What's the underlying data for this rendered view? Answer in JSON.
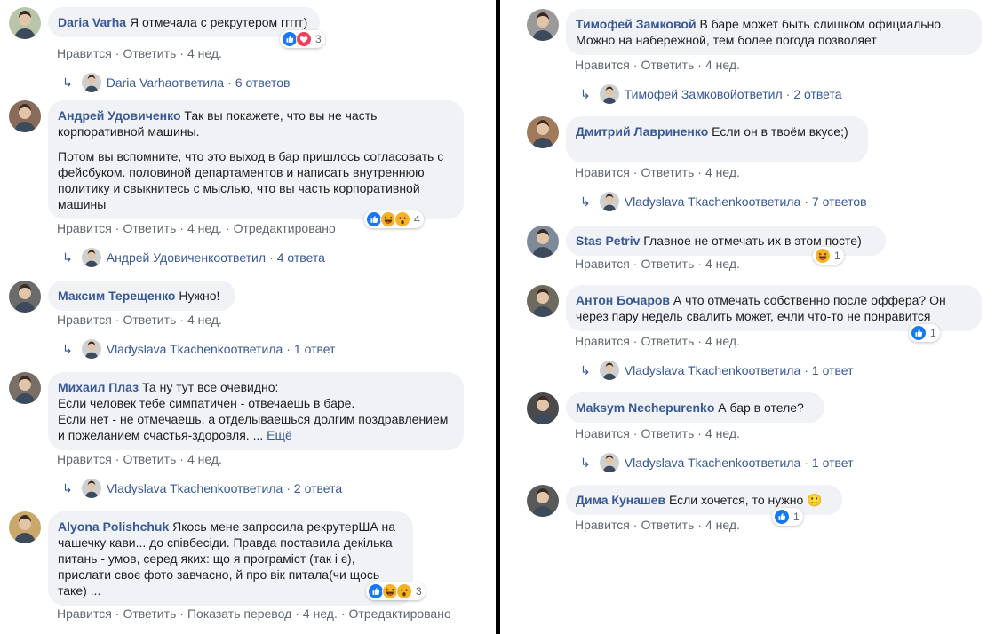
{
  "left_column": [
    {
      "author": "Daria Varha",
      "paragraphs": [
        "Я отмечала с рекрутером ггггг)"
      ],
      "reactions": {
        "icons": [
          "like-icon",
          "love-icon"
        ],
        "count": "3"
      },
      "actions": [
        "Нравится",
        "Ответить",
        "4 нед."
      ],
      "reply": {
        "author": "Daria Varha",
        "label": "ответила",
        "count": "6 ответов"
      },
      "avatar_color": "#b8c5a8"
    },
    {
      "author": "Андрей Удовиченко",
      "paragraphs": [
        "Так вы покажете, что вы не часть корпоративной машины.",
        "Потом вы вспомните, что это выход в бар пришлось согласовать с фейсбуком. половиной департаментов и написать внутреннюю политику и свыкнитесь с мыслью, что вы часть корпоративной машины"
      ],
      "reactions": {
        "icons": [
          "like-icon",
          "haha-icon",
          "wow-icon"
        ],
        "count": "4"
      },
      "actions": [
        "Нравится",
        "Ответить",
        "4 нед.",
        "Отредактировано"
      ],
      "reply": {
        "author": "Андрей Удовиченко",
        "label": "ответил",
        "count": "4 ответа"
      },
      "avatar_color": "#8a6a5a"
    },
    {
      "author": "Максим Терещенко",
      "paragraphs": [
        "Нужно!"
      ],
      "reactions": null,
      "actions": [
        "Нравится",
        "Ответить",
        "4 нед."
      ],
      "reply": {
        "author": "Vladyslava Tkachenko",
        "label": "ответила",
        "count": "1 ответ"
      },
      "avatar_color": "#6b6b6b"
    },
    {
      "author": "Михаил Плаз",
      "paragraphs": [
        "Та ну тут все очевидно:\nЕсли человек тебе симпатичен - отвечаешь в баре.\nЕсли нет - не отмечаешь, а отделываешься долгим поздравлением и пожеланием счастья-здоровля. ..."
      ],
      "more": "Ещё",
      "reactions": null,
      "actions": [
        "Нравится",
        "Ответить",
        "4 нед."
      ],
      "reply": {
        "author": "Vladyslava Tkachenko",
        "label": "ответила",
        "count": "2 ответа"
      },
      "avatar_color": "#7a6f66"
    },
    {
      "author": "Alyona Polishchuk",
      "paragraphs": [
        "Якось мене запросила рекрутерША на чашечку кави... до співбесіди. Правда поставила декілька питань - умов, серед яких: що я програміст (так і є), прислати своє фото завчасно, й про вік питала(чи щось таке) ..."
      ],
      "reactions": {
        "icons": [
          "like-icon",
          "haha-icon",
          "wow-icon"
        ],
        "count": "3"
      },
      "actions": [
        "Нравится",
        "Ответить",
        "Показать перевод",
        "4 нед.",
        "Отредактировано"
      ],
      "reply": null,
      "avatar_color": "#c9a86a"
    }
  ],
  "right_column": [
    {
      "author": "Тимофей Замковой",
      "paragraphs": [
        "В баре может быть слишком официально. Можно на набережной, тем более погода позволяет"
      ],
      "reactions": null,
      "actions": [
        "Нравится",
        "Ответить",
        "4 нед."
      ],
      "reply": {
        "author": "Тимофей Замковой",
        "label": "ответил",
        "count": "2 ответа"
      },
      "avatar_color": "#9a9a9a"
    },
    {
      "author": "Дмитрий Лавриненко",
      "paragraphs": [
        "Если он в твоём вкусе;)"
      ],
      "reactions": null,
      "actions": [
        "Нравится",
        "Ответить",
        "4 нед."
      ],
      "reply": {
        "author": "Vladyslava Tkachenko",
        "label": "ответила",
        "count": "7 ответов"
      },
      "avatar_color": "#a07a5a"
    },
    {
      "author": "Stas Petriv",
      "paragraphs": [
        "Главное не отмечать их в этом посте)"
      ],
      "reactions": {
        "icons": [
          "haha-icon"
        ],
        "count": "1"
      },
      "actions": [
        "Нравится",
        "Ответить",
        "4 нед."
      ],
      "reply": null,
      "avatar_color": "#7d8a9a"
    },
    {
      "author": "Антон Бочаров",
      "paragraphs": [
        "А что отмечать собственно после оффера? Он через пару недель свалить может, ечли что-то не понравится"
      ],
      "reactions": {
        "icons": [
          "like-icon"
        ],
        "count": "1"
      },
      "actions": [
        "Нравится",
        "Ответить",
        "4 нед."
      ],
      "reply": {
        "author": "Vladyslava Tkachenko",
        "label": "ответила",
        "count": "1 ответ"
      },
      "avatar_color": "#6e6a5e"
    },
    {
      "author": "Maksym Nechepurenko",
      "paragraphs": [
        "А бар в отеле?"
      ],
      "reactions": null,
      "actions": [
        "Нравится",
        "Ответить",
        "4 нед."
      ],
      "reply": {
        "author": "Vladyslava Tkachenko",
        "label": "ответила",
        "count": "1 ответ"
      },
      "avatar_color": "#4a4a4a"
    },
    {
      "author": "Дима Кунашев",
      "paragraphs": [
        "Если хочется, то нужно 🙂"
      ],
      "reactions": {
        "icons": [
          "like-icon"
        ],
        "count": "1"
      },
      "actions": [
        "Нравится",
        "Ответить",
        "4 нед."
      ],
      "reply": null,
      "avatar_color": "#5a5a5a"
    }
  ],
  "colors": {
    "link": "#385898",
    "muted": "#606770",
    "bubble": "#f0f2f5",
    "like": "#1877f2",
    "love": "#f33e58",
    "haha": "#f7b125"
  }
}
